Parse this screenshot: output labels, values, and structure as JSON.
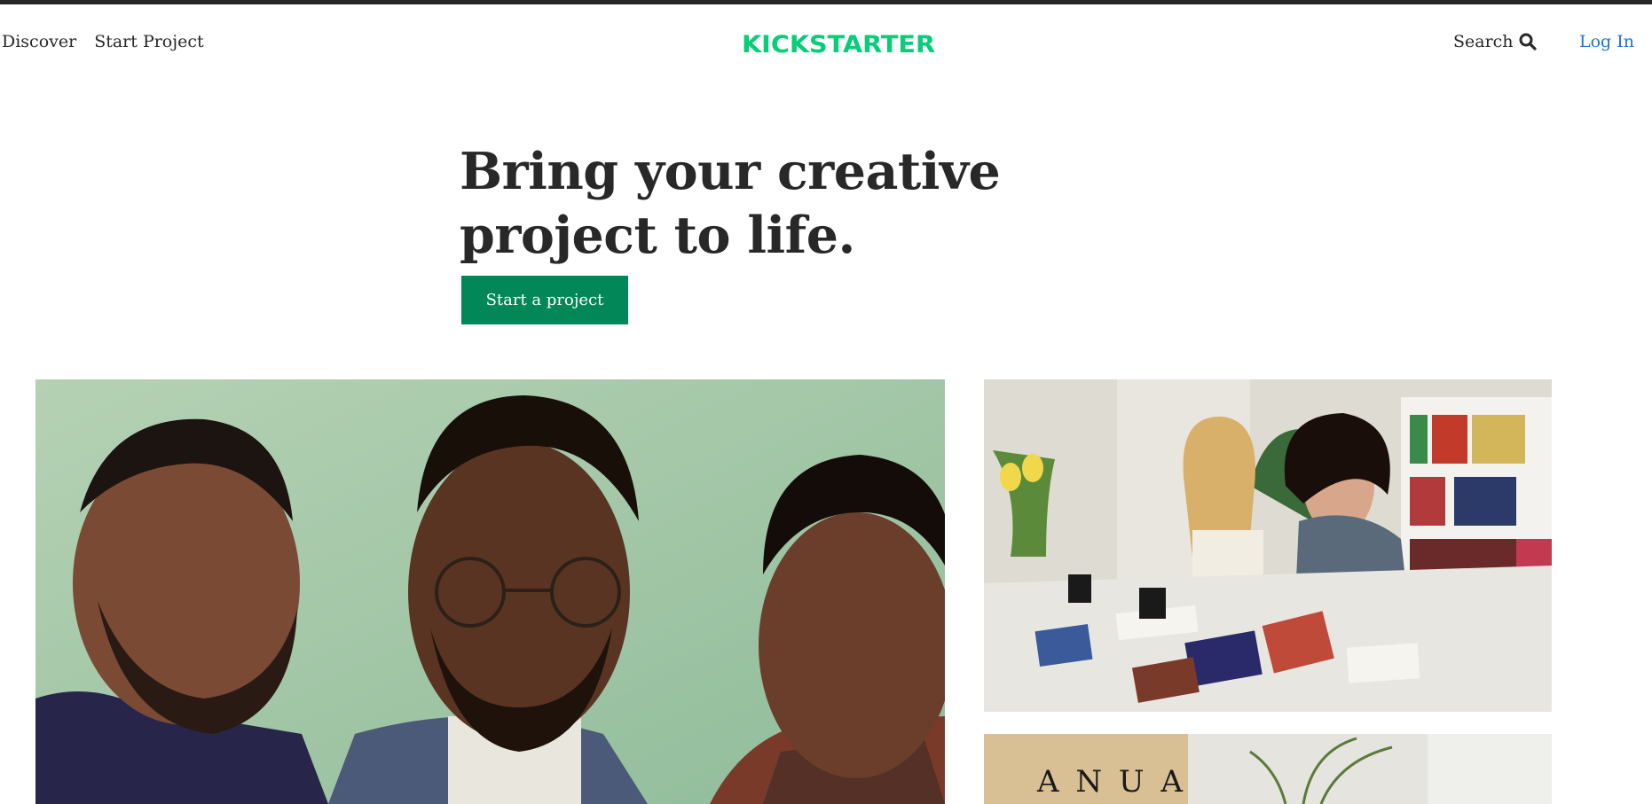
{
  "nav": {
    "discover": "Discover",
    "start_project": "Start Project",
    "logo_text": "KICKSTARTER",
    "search": "Search",
    "login": "Log In"
  },
  "hero": {
    "headline": "Bring your creative project to life.",
    "cta": "Start a project"
  },
  "photos": {
    "side2_sign": "A N U A"
  },
  "colors": {
    "brand_green": "#05ce78",
    "cta_green": "#028858",
    "link_blue": "#1a73d9",
    "text_dark": "#282828"
  }
}
